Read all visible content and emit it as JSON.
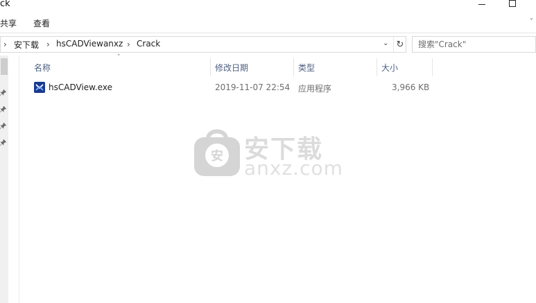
{
  "window": {
    "title": "ck",
    "min_glyph": "—",
    "max_glyph": "☐"
  },
  "ribbon": {
    "tabs": [
      "共享",
      "查看"
    ],
    "collapse_glyph": "˅"
  },
  "address": {
    "lead_sep": "›",
    "crumbs": [
      "安下载",
      "hsCADViewanxz",
      "Crack"
    ],
    "separator": "›",
    "dropdown_glyph": "⌄",
    "refresh_glyph": "↻"
  },
  "search": {
    "placeholder": "搜索\"Crack\""
  },
  "columns": {
    "name": "名称",
    "date": "修改日期",
    "type": "类型",
    "size": "大小",
    "sort_glyph": "˄"
  },
  "files": [
    {
      "name": "hsCADView.exe",
      "date": "2019-11-07 22:54",
      "type": "应用程序",
      "size": "3,966 KB",
      "icon": "hscadview-app-icon"
    }
  ],
  "watermark": {
    "cn": "安下载",
    "en": "anxz.com",
    "badge": "安"
  },
  "colors": {
    "header_text": "#4d6082",
    "secondary_text": "#6d6d6d",
    "app_icon": "#1a3a8f"
  }
}
